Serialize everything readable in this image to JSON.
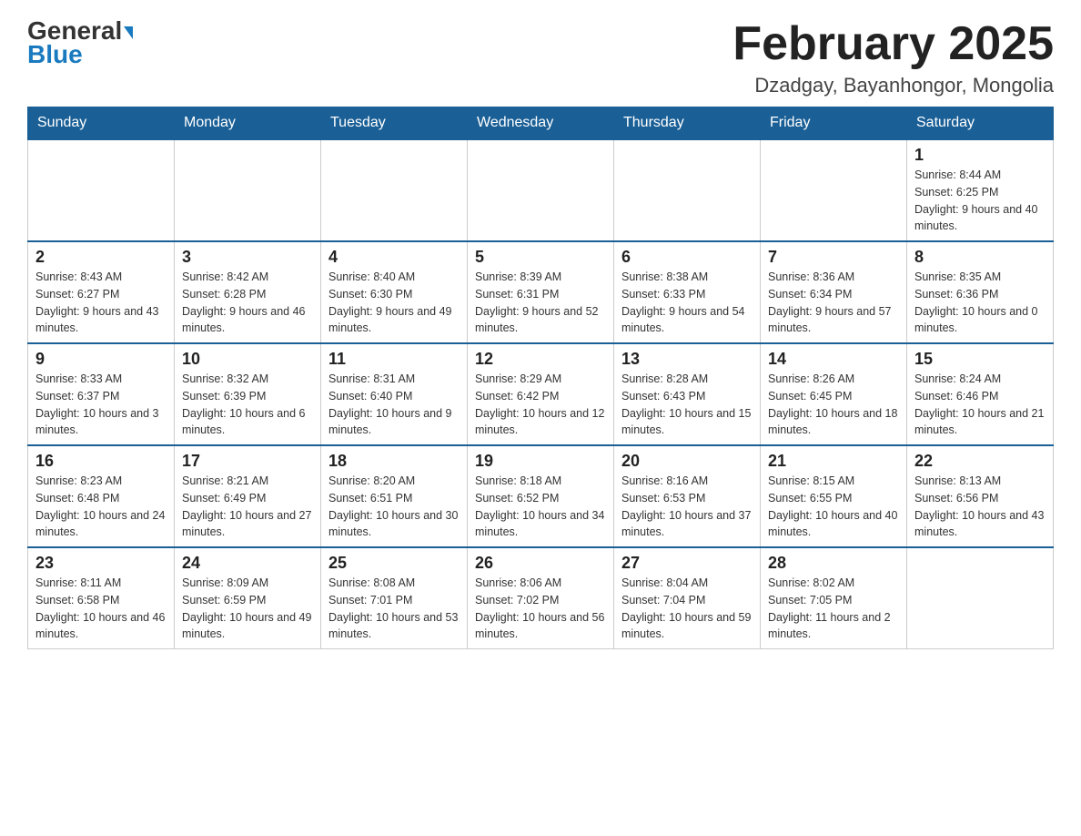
{
  "header": {
    "logo_line1": "General",
    "logo_line2": "Blue",
    "title": "February 2025",
    "subtitle": "Dzadgay, Bayanhongor, Mongolia"
  },
  "weekdays": [
    "Sunday",
    "Monday",
    "Tuesday",
    "Wednesday",
    "Thursday",
    "Friday",
    "Saturday"
  ],
  "weeks": [
    [
      {
        "day": "",
        "info": ""
      },
      {
        "day": "",
        "info": ""
      },
      {
        "day": "",
        "info": ""
      },
      {
        "day": "",
        "info": ""
      },
      {
        "day": "",
        "info": ""
      },
      {
        "day": "",
        "info": ""
      },
      {
        "day": "1",
        "info": "Sunrise: 8:44 AM\nSunset: 6:25 PM\nDaylight: 9 hours and 40 minutes."
      }
    ],
    [
      {
        "day": "2",
        "info": "Sunrise: 8:43 AM\nSunset: 6:27 PM\nDaylight: 9 hours and 43 minutes."
      },
      {
        "day": "3",
        "info": "Sunrise: 8:42 AM\nSunset: 6:28 PM\nDaylight: 9 hours and 46 minutes."
      },
      {
        "day": "4",
        "info": "Sunrise: 8:40 AM\nSunset: 6:30 PM\nDaylight: 9 hours and 49 minutes."
      },
      {
        "day": "5",
        "info": "Sunrise: 8:39 AM\nSunset: 6:31 PM\nDaylight: 9 hours and 52 minutes."
      },
      {
        "day": "6",
        "info": "Sunrise: 8:38 AM\nSunset: 6:33 PM\nDaylight: 9 hours and 54 minutes."
      },
      {
        "day": "7",
        "info": "Sunrise: 8:36 AM\nSunset: 6:34 PM\nDaylight: 9 hours and 57 minutes."
      },
      {
        "day": "8",
        "info": "Sunrise: 8:35 AM\nSunset: 6:36 PM\nDaylight: 10 hours and 0 minutes."
      }
    ],
    [
      {
        "day": "9",
        "info": "Sunrise: 8:33 AM\nSunset: 6:37 PM\nDaylight: 10 hours and 3 minutes."
      },
      {
        "day": "10",
        "info": "Sunrise: 8:32 AM\nSunset: 6:39 PM\nDaylight: 10 hours and 6 minutes."
      },
      {
        "day": "11",
        "info": "Sunrise: 8:31 AM\nSunset: 6:40 PM\nDaylight: 10 hours and 9 minutes."
      },
      {
        "day": "12",
        "info": "Sunrise: 8:29 AM\nSunset: 6:42 PM\nDaylight: 10 hours and 12 minutes."
      },
      {
        "day": "13",
        "info": "Sunrise: 8:28 AM\nSunset: 6:43 PM\nDaylight: 10 hours and 15 minutes."
      },
      {
        "day": "14",
        "info": "Sunrise: 8:26 AM\nSunset: 6:45 PM\nDaylight: 10 hours and 18 minutes."
      },
      {
        "day": "15",
        "info": "Sunrise: 8:24 AM\nSunset: 6:46 PM\nDaylight: 10 hours and 21 minutes."
      }
    ],
    [
      {
        "day": "16",
        "info": "Sunrise: 8:23 AM\nSunset: 6:48 PM\nDaylight: 10 hours and 24 minutes."
      },
      {
        "day": "17",
        "info": "Sunrise: 8:21 AM\nSunset: 6:49 PM\nDaylight: 10 hours and 27 minutes."
      },
      {
        "day": "18",
        "info": "Sunrise: 8:20 AM\nSunset: 6:51 PM\nDaylight: 10 hours and 30 minutes."
      },
      {
        "day": "19",
        "info": "Sunrise: 8:18 AM\nSunset: 6:52 PM\nDaylight: 10 hours and 34 minutes."
      },
      {
        "day": "20",
        "info": "Sunrise: 8:16 AM\nSunset: 6:53 PM\nDaylight: 10 hours and 37 minutes."
      },
      {
        "day": "21",
        "info": "Sunrise: 8:15 AM\nSunset: 6:55 PM\nDaylight: 10 hours and 40 minutes."
      },
      {
        "day": "22",
        "info": "Sunrise: 8:13 AM\nSunset: 6:56 PM\nDaylight: 10 hours and 43 minutes."
      }
    ],
    [
      {
        "day": "23",
        "info": "Sunrise: 8:11 AM\nSunset: 6:58 PM\nDaylight: 10 hours and 46 minutes."
      },
      {
        "day": "24",
        "info": "Sunrise: 8:09 AM\nSunset: 6:59 PM\nDaylight: 10 hours and 49 minutes."
      },
      {
        "day": "25",
        "info": "Sunrise: 8:08 AM\nSunset: 7:01 PM\nDaylight: 10 hours and 53 minutes."
      },
      {
        "day": "26",
        "info": "Sunrise: 8:06 AM\nSunset: 7:02 PM\nDaylight: 10 hours and 56 minutes."
      },
      {
        "day": "27",
        "info": "Sunrise: 8:04 AM\nSunset: 7:04 PM\nDaylight: 10 hours and 59 minutes."
      },
      {
        "day": "28",
        "info": "Sunrise: 8:02 AM\nSunset: 7:05 PM\nDaylight: 11 hours and 2 minutes."
      },
      {
        "day": "",
        "info": ""
      }
    ]
  ]
}
